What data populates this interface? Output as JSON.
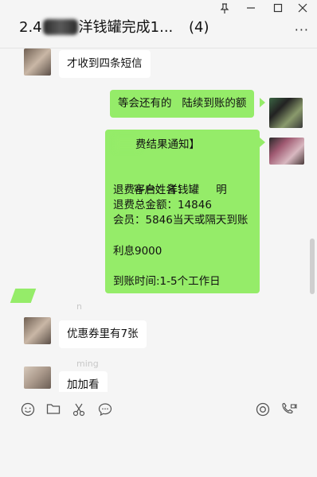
{
  "window": {
    "title_prefix": "2.4",
    "title_suffix": "洋钱罐完成1...",
    "count": "(4)",
    "pin_icon": "pin-icon",
    "minimize_icon": "minimize-icon",
    "maximize_icon": "maximize-icon",
    "close_icon": "close-icon",
    "more_label": "···"
  },
  "messages": [
    {
      "side": "left",
      "text": "才收到四条短信"
    },
    {
      "side": "right",
      "text": "等会还有的   陆续到账的额"
    }
  ],
  "notice": {
    "header": "费结果通知】",
    "name_label": "客户姓名：",
    "name_value": "明",
    "platform": "退费平台：洋钱罐",
    "total": "退费总金额：14846",
    "member": "会员：5846当天或隔天到账",
    "interest": "利息9000",
    "arrival": "到账时间:1-5个工作日"
  },
  "messages2": [
    {
      "side": "left",
      "text": "优惠券里有7张"
    },
    {
      "side": "left",
      "text": "加加看"
    }
  ],
  "ghost_text": [
    "n",
    "ming"
  ],
  "toolbar": {
    "emoji_icon": "emoji-icon",
    "folder_icon": "folder-icon",
    "scissors_icon": "scissors-icon",
    "chat_icon": "chat-bubble-icon",
    "live_icon": "live-icon",
    "call_icon": "video-call-icon"
  }
}
